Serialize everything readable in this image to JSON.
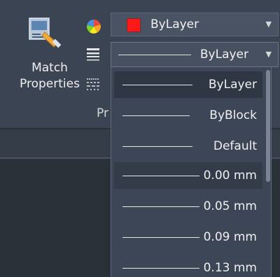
{
  "ribbon": {
    "match_properties_label": "Match\nProperties",
    "panel_title": "Pr"
  },
  "color_combo": {
    "value": "ByLayer",
    "swatch_color": "#ff1a1a"
  },
  "lineweight_combo": {
    "value": "ByLayer"
  },
  "lineweight_dropdown": {
    "items": [
      {
        "label": "ByLayer"
      },
      {
        "label": "ByBlock"
      },
      {
        "label": "Default"
      },
      {
        "label": "0.00 mm"
      },
      {
        "label": "0.05 mm"
      },
      {
        "label": "0.09 mm"
      },
      {
        "label": "0.13 mm"
      }
    ]
  },
  "icons": {
    "match": "match-properties-icon",
    "color_wheel": "color-wheel-icon",
    "lineweight": "lineweight-icon",
    "linetype": "linetype-icon",
    "combo_arrow": "dropdown-arrow-icon"
  }
}
